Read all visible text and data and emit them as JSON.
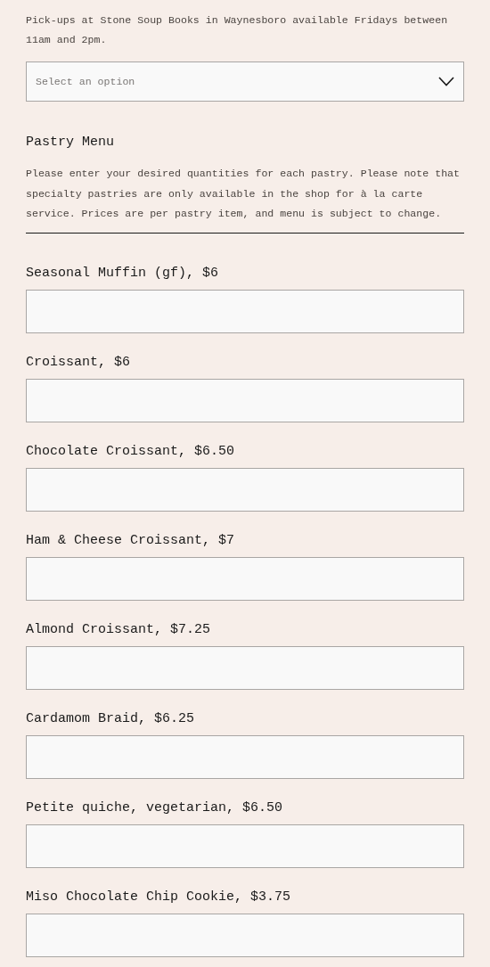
{
  "pickup_note": "Pick-ups at Stone Soup Books in Waynesboro available Fridays between 11am and 2pm.",
  "pickup_select": {
    "placeholder": "Select an option"
  },
  "section": {
    "title": "Pastry Menu",
    "description": "Please enter your desired quantities for each pastry. Please note that specialty pastries are only available in the shop for à la carte service. Prices are per pastry item, and menu is subject to change."
  },
  "fields": [
    {
      "label": "Seasonal Muffin (gf), $6"
    },
    {
      "label": "Croissant, $6"
    },
    {
      "label": "Chocolate Croissant, $6.50"
    },
    {
      "label": "Ham & Cheese Croissant, $7"
    },
    {
      "label": "Almond Croissant, $7.25"
    },
    {
      "label": "Cardamom Braid, $6.25"
    },
    {
      "label": "Petite quiche, vegetarian, $6.50"
    },
    {
      "label": "Miso Chocolate Chip Cookie, $3.75"
    }
  ]
}
